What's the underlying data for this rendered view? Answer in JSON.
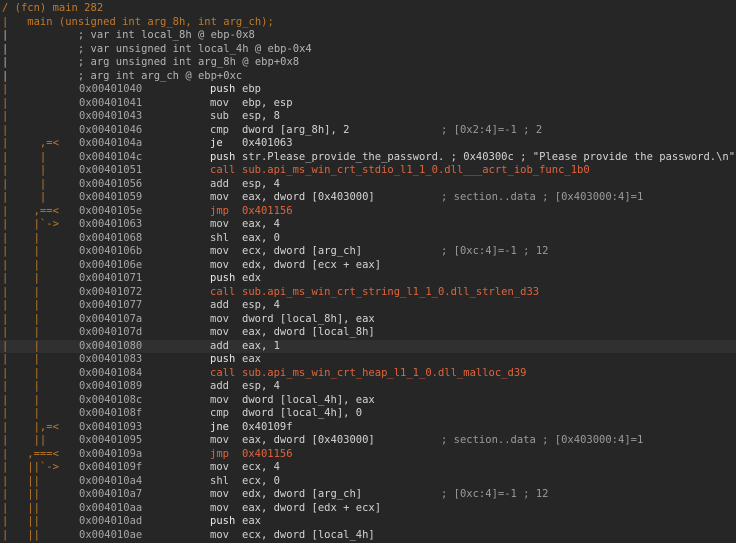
{
  "header": {
    "fcn_line": "/ (fcn) main 282",
    "sig_line": "|   main (unsigned int arg_8h, int arg_ch);"
  },
  "decls": [
    "|           ; var int local_8h @ ebp-0x8",
    "|           ; var unsigned int local_4h @ ebp-0x4",
    "|           ; arg unsigned int arg_8h @ ebp+0x8",
    "|           ; arg int arg_ch @ ebp+0xc"
  ],
  "instructions": [
    {
      "g": "|",
      "addr": "0x00401040",
      "mn": "push",
      "ops": "ebp",
      "cmt": "",
      "type": "push"
    },
    {
      "g": "|",
      "addr": "0x00401041",
      "mn": "mov",
      "ops": "ebp, esp",
      "cmt": "",
      "type": "mov"
    },
    {
      "g": "|",
      "addr": "0x00401043",
      "mn": "sub",
      "ops": "esp, 8",
      "cmt": "",
      "type": "sub"
    },
    {
      "g": "|",
      "addr": "0x00401046",
      "mn": "cmp",
      "ops": "dword [arg_8h], 2",
      "cmt": "; [0x2:4]=-1 ; 2",
      "type": "cmp"
    },
    {
      "g": "|     ,=< ",
      "addr": "0x0040104a",
      "mn": "je",
      "ops": "0x401063",
      "cmt": "",
      "type": "je"
    },
    {
      "g": "|     |",
      "addr": "0x0040104c",
      "mn": "push",
      "ops": "str.Please_provide_the_password. ; 0x40300c ; \"Please provide the password.\\n\"",
      "cmt": "",
      "type": "push"
    },
    {
      "g": "|     |",
      "addr": "0x00401051",
      "mn": "call",
      "ops": "sub.api_ms_win_crt_stdio_l1_1_0.dll___acrt_iob_func_1b0",
      "cmt": "",
      "type": "call"
    },
    {
      "g": "|     |",
      "addr": "0x00401056",
      "mn": "add",
      "ops": "esp, 4",
      "cmt": "",
      "type": "add"
    },
    {
      "g": "|     |",
      "addr": "0x00401059",
      "mn": "mov",
      "ops": "eax, dword [0x403000]",
      "cmt": "; section..data ; [0x403000:4]=1",
      "type": "mov"
    },
    {
      "g": "|    ,==< ",
      "addr": "0x0040105e",
      "mn": "jmp",
      "ops": "0x401156",
      "cmt": "",
      "type": "jmp"
    },
    {
      "g": "|    |`-> ",
      "addr": "0x00401063",
      "mn": "mov",
      "ops": "eax, 4",
      "cmt": "",
      "type": "mov"
    },
    {
      "g": "|    |",
      "addr": "0x00401068",
      "mn": "shl",
      "ops": "eax, 0",
      "cmt": "",
      "type": "shl"
    },
    {
      "g": "|    |",
      "addr": "0x0040106b",
      "mn": "mov",
      "ops": "ecx, dword [arg_ch]",
      "cmt": "; [0xc:4]=-1 ; 12",
      "type": "mov"
    },
    {
      "g": "|    |",
      "addr": "0x0040106e",
      "mn": "mov",
      "ops": "edx, dword [ecx + eax]",
      "cmt": "",
      "type": "mov"
    },
    {
      "g": "|    |",
      "addr": "0x00401071",
      "mn": "push",
      "ops": "edx",
      "cmt": "",
      "type": "push"
    },
    {
      "g": "|    |",
      "addr": "0x00401072",
      "mn": "call",
      "ops": "sub.api_ms_win_crt_string_l1_1_0.dll_strlen_d33",
      "cmt": "",
      "type": "call"
    },
    {
      "g": "|    |",
      "addr": "0x00401077",
      "mn": "add",
      "ops": "esp, 4",
      "cmt": "",
      "type": "add"
    },
    {
      "g": "|    |",
      "addr": "0x0040107a",
      "mn": "mov",
      "ops": "dword [local_8h], eax",
      "cmt": "",
      "type": "mov"
    },
    {
      "g": "|    |",
      "addr": "0x0040107d",
      "mn": "mov",
      "ops": "eax, dword [local_8h]",
      "cmt": "",
      "type": "mov"
    },
    {
      "g": "|    |",
      "addr": "0x00401080",
      "mn": "add",
      "ops": "eax, 1",
      "cmt": "",
      "type": "add",
      "hl": true
    },
    {
      "g": "|    |",
      "addr": "0x00401083",
      "mn": "push",
      "ops": "eax",
      "cmt": "",
      "type": "push"
    },
    {
      "g": "|    |",
      "addr": "0x00401084",
      "mn": "call",
      "ops": "sub.api_ms_win_crt_heap_l1_1_0.dll_malloc_d39",
      "cmt": "",
      "type": "call"
    },
    {
      "g": "|    |",
      "addr": "0x00401089",
      "mn": "add",
      "ops": "esp, 4",
      "cmt": "",
      "type": "add"
    },
    {
      "g": "|    |",
      "addr": "0x0040108c",
      "mn": "mov",
      "ops": "dword [local_4h], eax",
      "cmt": "",
      "type": "mov"
    },
    {
      "g": "|    |",
      "addr": "0x0040108f",
      "mn": "cmp",
      "ops": "dword [local_4h], 0",
      "cmt": "",
      "type": "cmp"
    },
    {
      "g": "|    |,=< ",
      "addr": "0x00401093",
      "mn": "jne",
      "ops": "0x40109f",
      "cmt": "",
      "type": "jne"
    },
    {
      "g": "|    ||",
      "addr": "0x00401095",
      "mn": "mov",
      "ops": "eax, dword [0x403000]",
      "cmt": "; section..data ; [0x403000:4]=1",
      "type": "mov"
    },
    {
      "g": "|   ,===< ",
      "addr": "0x0040109a",
      "mn": "jmp",
      "ops": "0x401156",
      "cmt": "",
      "type": "jmp"
    },
    {
      "g": "|   ||`-> ",
      "addr": "0x0040109f",
      "mn": "mov",
      "ops": "ecx, 4",
      "cmt": "",
      "type": "mov"
    },
    {
      "g": "|   ||",
      "addr": "0x004010a4",
      "mn": "shl",
      "ops": "ecx, 0",
      "cmt": "",
      "type": "shl"
    },
    {
      "g": "|   ||",
      "addr": "0x004010a7",
      "mn": "mov",
      "ops": "edx, dword [arg_ch]",
      "cmt": "; [0xc:4]=-1 ; 12",
      "type": "mov"
    },
    {
      "g": "|   ||",
      "addr": "0x004010aa",
      "mn": "mov",
      "ops": "eax, dword [edx + ecx]",
      "cmt": "",
      "type": "mov"
    },
    {
      "g": "|   ||",
      "addr": "0x004010ad",
      "mn": "push",
      "ops": "eax",
      "cmt": "",
      "type": "push"
    },
    {
      "g": "|   ||",
      "addr": "0x004010ae",
      "mn": "mov",
      "ops": "ecx, dword [local_4h]",
      "cmt": "",
      "type": "mov"
    }
  ],
  "colors": {
    "background": "#262626",
    "gutter": "#c07a2a",
    "call_jmp": "#e0643c",
    "address": "#a6a6a6"
  }
}
